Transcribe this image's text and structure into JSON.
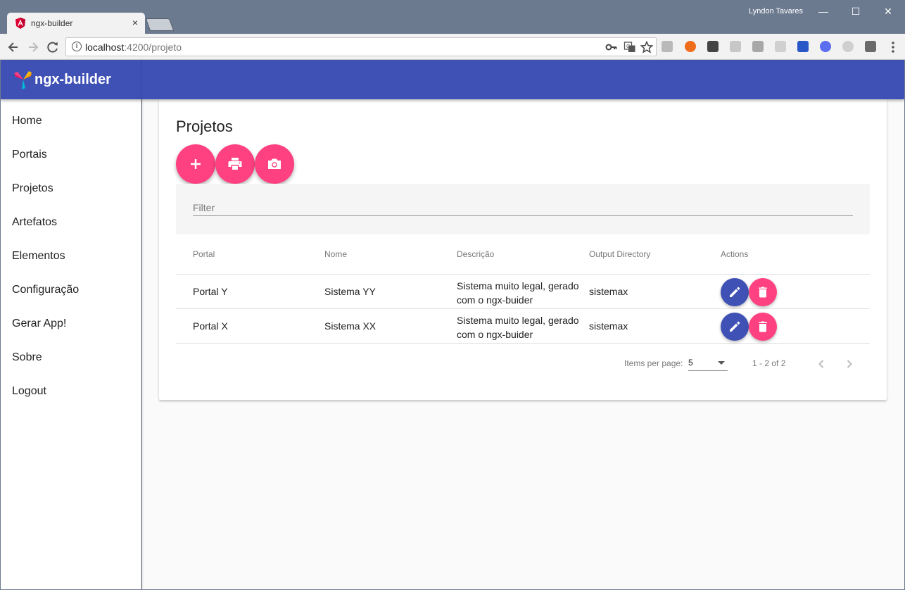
{
  "browser": {
    "tab_title": "ngx-builder",
    "tab_close": "×",
    "user_name": "Lyndon Tavares",
    "window_controls": {
      "minimize": "—",
      "maximize": "☐",
      "close": "✕"
    },
    "url_host": "localhost",
    "url_path": ":4200/projeto",
    "icons": [
      "back-icon",
      "forward-icon",
      "reload-icon",
      "info-icon",
      "key-icon",
      "translate-icon",
      "star-icon",
      "menu-icon"
    ]
  },
  "app": {
    "brand": "ngx-builder",
    "colors": {
      "primary": "#3f51b5",
      "accent": "#ff4081"
    }
  },
  "sidenav": {
    "items": [
      {
        "label": "Home"
      },
      {
        "label": "Portais"
      },
      {
        "label": "Projetos"
      },
      {
        "label": "Artefatos"
      },
      {
        "label": "Elementos"
      },
      {
        "label": "Configuração"
      },
      {
        "label": "Gerar App!"
      },
      {
        "label": "Sobre"
      },
      {
        "label": "Logout"
      }
    ]
  },
  "page": {
    "title": "Projetos",
    "actions": [
      "add-icon",
      "print-icon",
      "camera-icon"
    ],
    "filter": {
      "placeholder": "Filter",
      "value": ""
    },
    "table": {
      "columns": [
        "Portal",
        "Nome",
        "Descrição",
        "Output Directory",
        "Actions"
      ],
      "rows": [
        {
          "portal": "Portal Y",
          "nome": "Sistema YY",
          "descricao_line1": "Sistema muito legal, gerado",
          "descricao_line2": "com o ngx-buider",
          "output": "sistemax"
        },
        {
          "portal": "Portal X",
          "nome": "Sistema XX",
          "descricao_line1": "Sistema muito legal, gerado",
          "descricao_line2": "com o ngx-buider",
          "output": "sistemax"
        }
      ]
    },
    "paginator": {
      "items_per_page_label": "Items per page:",
      "page_size": "5",
      "range": "1 - 2 of 2"
    }
  }
}
